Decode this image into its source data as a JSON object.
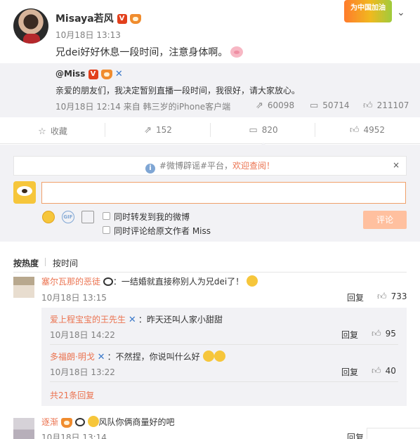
{
  "post": {
    "author": "Misaya若风",
    "verified_badge": "V",
    "time": "10月18日 13:13",
    "text": "兄dei好好休息一段时间，注意身体啊。",
    "banner_text": "为中国加油"
  },
  "quoted": {
    "author": "@Miss",
    "verified_badge": "V",
    "text": "亲爱的朋友们，我决定暂别直播一段时间，我很好，请大家放心。",
    "time_source": "10月18日 12:14 来自 韩三岁的iPhone客户端",
    "reposts": "60098",
    "comments": "50714",
    "likes": "211107"
  },
  "actions": {
    "favorite": "收藏",
    "repost": "152",
    "comment": "820",
    "like": "4952"
  },
  "notice": {
    "prefix": "#微博辟谣#平台，",
    "link": "欢迎查阅！",
    "close": "×"
  },
  "composer": {
    "input_value": "",
    "option_repost": "同时转发到我的微博",
    "option_comment_original": "同时评论给原文作者 Miss",
    "submit": "评论",
    "gif_label": "GIF"
  },
  "sort": {
    "hot": "按热度",
    "time": "按时间"
  },
  "comments": [
    {
      "author": "塞尔瓦那的恶徒",
      "text": "：一结婚就直接称别人为兄dei了！",
      "time": "10月18日 13:15",
      "reply": "回复",
      "likes": "733",
      "replies": [
        {
          "author": "爱上程宝宝的王先生",
          "text": "：昨天还叫人家小甜甜",
          "time": "10月18日 14:22",
          "reply": "回复",
          "likes": "95"
        },
        {
          "author": "多福朗·明戈",
          "text": "：不然捏，你说叫什么好",
          "time": "10月18日 13:22",
          "reply": "回复",
          "likes": "40"
        }
      ],
      "more": "共21条回复"
    },
    {
      "author": "逐渐",
      "text": "风队你俩商量好的吧",
      "time": "10月18日 13:14",
      "reply": "回复"
    }
  ],
  "colors": {
    "accent": "#eb7350",
    "muted": "#808080",
    "panel": "#f2f2f5"
  }
}
